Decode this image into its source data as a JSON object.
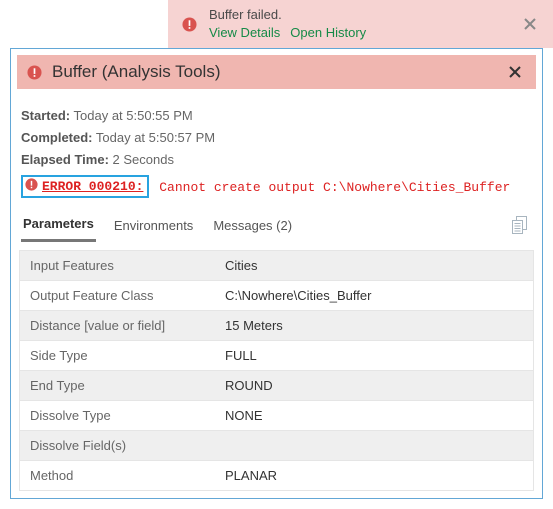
{
  "notification": {
    "title": "Buffer failed.",
    "view_details": "View Details",
    "open_history": "Open History"
  },
  "panel": {
    "title": "Buffer (Analysis Tools)"
  },
  "meta": {
    "started_label": "Started:",
    "started_value": "Today at 5:50:55 PM",
    "completed_label": "Completed:",
    "completed_value": "Today at 5:50:57 PM",
    "elapsed_label": "Elapsed Time:",
    "elapsed_value": "2 Seconds"
  },
  "error": {
    "code": "ERROR 000210:",
    "message": "Cannot create output C:\\Nowhere\\Cities_Buffer"
  },
  "tabs": {
    "parameters": "Parameters",
    "environments": "Environments",
    "messages": "Messages (2)"
  },
  "params": [
    {
      "k": "Input Features",
      "v": "Cities"
    },
    {
      "k": "Output Feature Class",
      "v": "C:\\Nowhere\\Cities_Buffer"
    },
    {
      "k": "Distance [value or field]",
      "v": "15 Meters"
    },
    {
      "k": "Side Type",
      "v": "FULL"
    },
    {
      "k": "End Type",
      "v": "ROUND"
    },
    {
      "k": "Dissolve Type",
      "v": "NONE"
    },
    {
      "k": "Dissolve Field(s)",
      "v": ""
    },
    {
      "k": "Method",
      "v": "PLANAR"
    }
  ]
}
